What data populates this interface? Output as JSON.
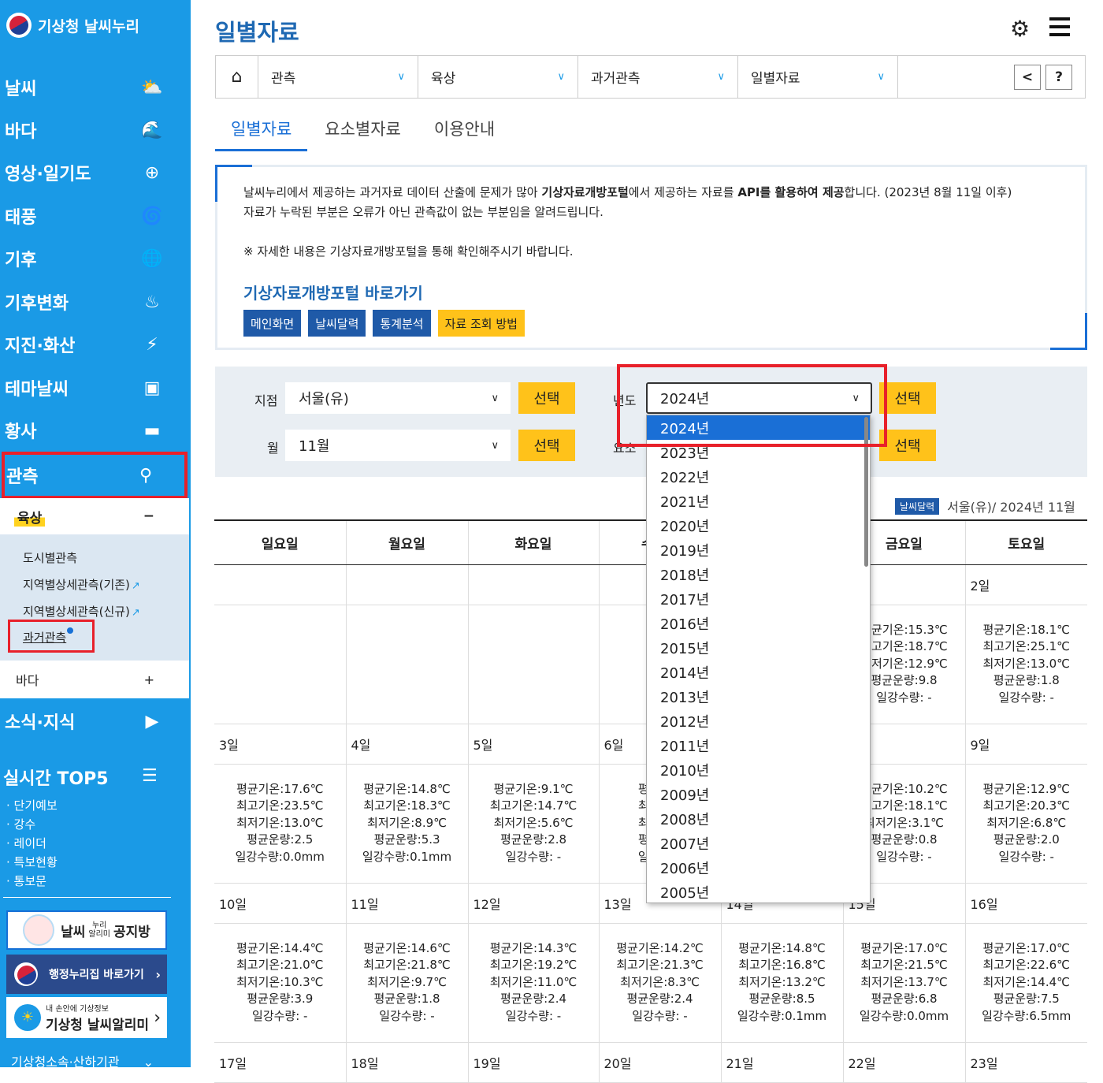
{
  "sidebar": {
    "logo": "기상청 날씨누리",
    "menu": [
      {
        "label": "날씨",
        "icon": "⛅"
      },
      {
        "label": "바다",
        "icon": "🌊"
      },
      {
        "label": "영상·일기도",
        "icon": "⊕"
      },
      {
        "label": "태풍",
        "icon": "🌀"
      },
      {
        "label": "기후",
        "icon": "🌐"
      },
      {
        "label": "기후변화",
        "icon": "♨"
      },
      {
        "label": "지진·화산",
        "icon": "⚡"
      },
      {
        "label": "테마날씨",
        "icon": "▣"
      },
      {
        "label": "황사",
        "icon": "▬"
      },
      {
        "label": "관측",
        "icon": "⚲"
      },
      {
        "label": "소식·지식",
        "icon": "▶"
      }
    ],
    "sub_header": {
      "label": "육상",
      "toggle": "−"
    },
    "sub_links": [
      "도시별관측",
      "지역별상세관측(기존)",
      "지역별상세관측(신규)",
      "과거관측"
    ],
    "sea": {
      "label": "바다",
      "toggle": "+"
    },
    "top5": {
      "title": "실시간 TOP5",
      "items": [
        "단기예보",
        "강수",
        "레이더",
        "특보현황",
        "통보문"
      ]
    },
    "banner1": {
      "title": "날씨",
      "small": "누리\n알리미",
      "suffix": "공지방"
    },
    "banner2": "행정누리집 바로가기",
    "banner3": {
      "small": "내 손안에 기상정보",
      "title": "기상청 날씨알리미"
    },
    "bottom_link": "기상청소속·산하기관"
  },
  "main": {
    "title": "일별자료",
    "breadcrumb": [
      "관측",
      "육상",
      "과거관측",
      "일별자료"
    ],
    "tabs": [
      "일별자료",
      "요소별자료",
      "이용안내"
    ],
    "notice": {
      "line1_a": "날씨누리에서 제공하는 과거자료 데이터 산출에 문제가 많아 ",
      "line1_b": "기상자료개방포털",
      "line1_c": "에서 제공하는 자료를 ",
      "line1_d": "API를 활용하여 제공",
      "line1_e": "합니다. (2023년 8월 11일 이후)",
      "line2": "자료가 누락된 부분은 오류가 아닌 관측값이 없는 부분임을 알려드립니다.",
      "note": "※ 자세한 내용은 기상자료개방포털을 통해 확인해주시기 바랍니다.",
      "link": "기상자료개방포털 바로가기",
      "buttons": [
        "메인화면",
        "날씨달력",
        "통계분석",
        "자료 조회 방법"
      ]
    },
    "filter": {
      "station_label": "지점",
      "station_value": "서울(유)",
      "month_label": "월",
      "month_value": "11월",
      "year_label": "년도",
      "year_value": "2024년",
      "element_label": "요소",
      "select_btn": "선택"
    },
    "calendar_info": {
      "badge": "날씨달력",
      "text": "서울(유)/ 2024년 11월"
    },
    "weekdays": [
      "일요일",
      "월요일",
      "화요일",
      "수요일",
      "목요일",
      "금요일",
      "토요일"
    ],
    "weeks": [
      {
        "days": [
          "",
          "",
          "",
          "",
          "",
          "",
          "2일"
        ],
        "data": [
          "",
          "",
          "",
          "",
          "",
          "평균기온:15.3℃\n최고기온:18.7℃\n최저기온:12.9℃\n평균운량:9.8\n일강수량: -",
          "평균기온:18.1℃\n최고기온:25.1℃\n최저기온:13.0℃\n평균운량:1.8\n일강수량: -"
        ]
      },
      {
        "days": [
          "3일",
          "4일",
          "5일",
          "6일",
          "",
          "",
          "9일"
        ],
        "data": [
          "평균기온:17.6℃\n최고기온:23.5℃\n최저기온:13.0℃\n평균운량:2.5\n일강수량:0.0mm",
          "평균기온:14.8℃\n최고기온:18.3℃\n최저기온:8.9℃\n평균운량:5.3\n일강수량:0.1mm",
          "평균기온:9.1℃\n최고기온:14.7℃\n최저기온:5.6℃\n평균운량:2.8\n일강수량: -",
          "평균기온\n최고기온\n최저기온\n평균운량\n일강수량",
          "",
          "평균기온:10.2℃\n최고기온:18.1℃\n최저기온:3.1℃\n평균운량:0.8\n일강수량: -",
          "평균기온:12.9℃\n최고기온:20.3℃\n최저기온:6.8℃\n평균운량:2.0\n일강수량: -"
        ]
      },
      {
        "days": [
          "10일",
          "11일",
          "12일",
          "13일",
          "14일",
          "15일",
          "16일"
        ],
        "data": [
          "평균기온:14.4℃\n최고기온:21.0℃\n최저기온:10.3℃\n평균운량:3.9\n일강수량: -",
          "평균기온:14.6℃\n최고기온:21.8℃\n최저기온:9.7℃\n평균운량:1.8\n일강수량: -",
          "평균기온:14.3℃\n최고기온:19.2℃\n최저기온:11.0℃\n평균운량:2.4\n일강수량: -",
          "평균기온:14.2℃\n최고기온:21.3℃\n최저기온:8.3℃\n평균운량:2.4\n일강수량: -",
          "평균기온:14.8℃\n최고기온:16.8℃\n최저기온:13.2℃\n평균운량:8.5\n일강수량:0.1mm",
          "평균기온:17.0℃\n최고기온:21.5℃\n최저기온:13.7℃\n평균운량:6.8\n일강수량:0.0mm",
          "평균기온:17.0℃\n최고기온:22.6℃\n최저기온:14.4℃\n평균운량:7.5\n일강수량:6.5mm"
        ]
      },
      {
        "days": [
          "17일",
          "18일",
          "19일",
          "20일",
          "21일",
          "22일",
          "23일"
        ],
        "data": []
      }
    ],
    "year_options": [
      "2024년",
      "2023년",
      "2022년",
      "2021년",
      "2020년",
      "2019년",
      "2018년",
      "2017년",
      "2016년",
      "2015년",
      "2014년",
      "2013년",
      "2012년",
      "2011년",
      "2010년",
      "2009년",
      "2008년",
      "2007년",
      "2006년",
      "2005년"
    ]
  }
}
